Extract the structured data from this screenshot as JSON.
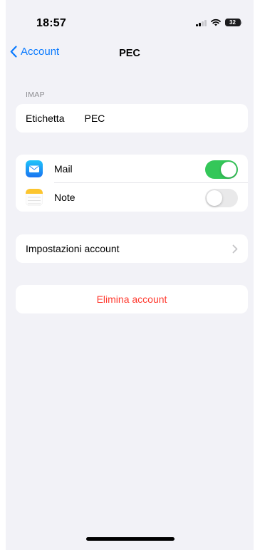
{
  "status_bar": {
    "time": "18:57",
    "battery_level": "32"
  },
  "nav": {
    "back_label": "Account",
    "title": "PEC"
  },
  "imap_section": {
    "header": "IMAP",
    "label_field": {
      "label": "Etichetta",
      "value": "PEC"
    }
  },
  "apps": [
    {
      "name": "Mail",
      "icon": "mail-icon",
      "enabled": true
    },
    {
      "name": "Note",
      "icon": "notes-icon",
      "enabled": false
    }
  ],
  "account_settings": {
    "label": "Impostazioni account"
  },
  "delete": {
    "label": "Elimina account"
  },
  "colors": {
    "accent": "#0a7aff",
    "toggle_on": "#34c759",
    "toggle_off": "#e9e9ea",
    "destructive": "#ff3b30",
    "background": "#f2f2f7"
  }
}
